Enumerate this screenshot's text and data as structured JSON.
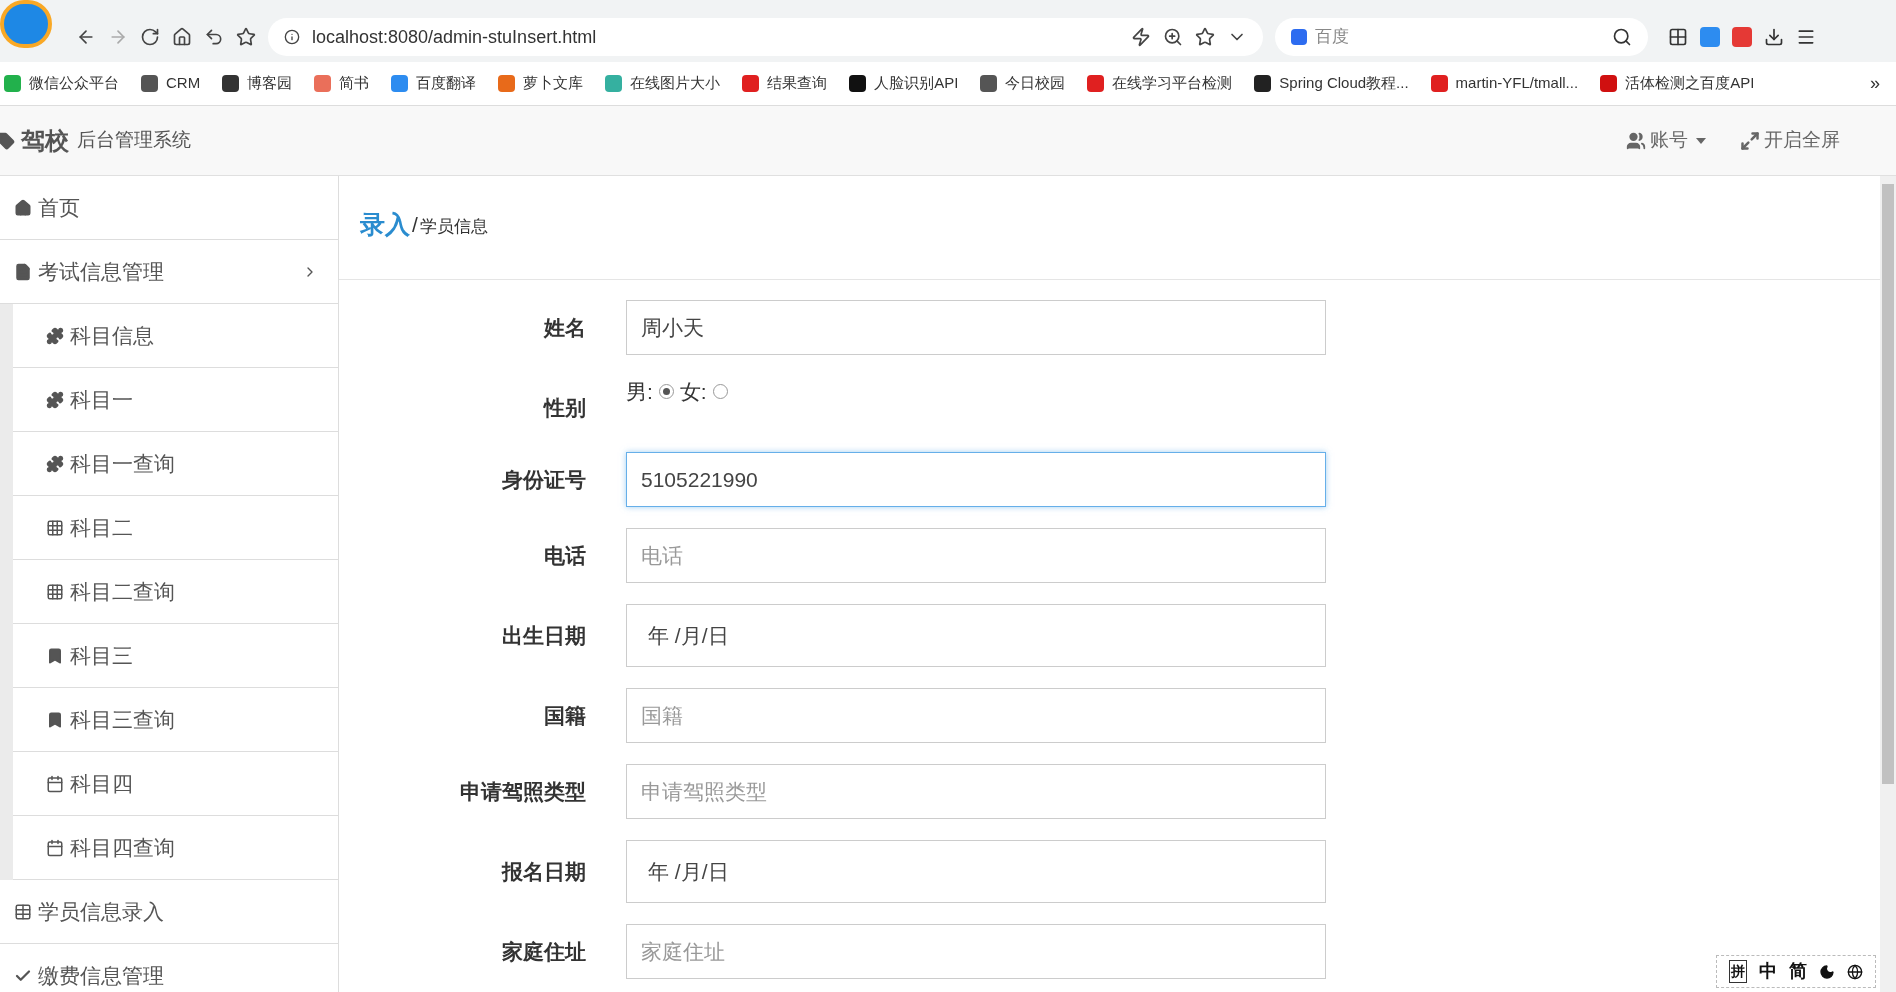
{
  "browser": {
    "url": "localhost:8080/admin-stuInsert.html",
    "search_placeholder": "百度"
  },
  "bookmarks": [
    {
      "label": "微信公众平台",
      "color": "#22b14c"
    },
    {
      "label": "CRM",
      "color": "#555555"
    },
    {
      "label": "博客园",
      "color": "#333333"
    },
    {
      "label": "简书",
      "color": "#ea6f5a"
    },
    {
      "label": "百度翻译",
      "color": "#2d8cf0"
    },
    {
      "label": "萝卜文库",
      "color": "#e86a1a"
    },
    {
      "label": "在线图片大小",
      "color": "#35b0a0"
    },
    {
      "label": "结果查询",
      "color": "#e02020"
    },
    {
      "label": "人脸识别API",
      "color": "#111111"
    },
    {
      "label": "今日校园",
      "color": "#555555"
    },
    {
      "label": "在线学习平台检测",
      "color": "#e02020"
    },
    {
      "label": "Spring Cloud教程...",
      "color": "#222222"
    },
    {
      "label": "martin-YFL/tmall...",
      "color": "#e02020"
    },
    {
      "label": "活体检测之百度API",
      "color": "#d01010"
    }
  ],
  "bookmarks_more": "»",
  "header": {
    "brand": "驾校",
    "subtitle": "后台管理系统",
    "account": "账号",
    "fullscreen": "开启全屏"
  },
  "sidebar": [
    {
      "label": "首页"
    },
    {
      "label": "考试信息管理",
      "expanded": true,
      "children": [
        {
          "label": "科目信息"
        },
        {
          "label": "科目一"
        },
        {
          "label": "科目一查询"
        },
        {
          "label": "科目二"
        },
        {
          "label": "科目二查询"
        },
        {
          "label": "科目三"
        },
        {
          "label": "科目三查询"
        },
        {
          "label": "科目四"
        },
        {
          "label": "科目四查询"
        }
      ]
    },
    {
      "label": "学员信息录入"
    },
    {
      "label": "缴费信息管理"
    }
  ],
  "breadcrumb": {
    "current": "录入",
    "separator": "/",
    "section": "学员信息"
  },
  "form": [
    {
      "kind": "text",
      "label": "姓名",
      "value": "周小天",
      "focused": false
    },
    {
      "kind": "radio",
      "label": "性别",
      "options": [
        {
          "label": "男:",
          "selected": true
        },
        {
          "label": "女:",
          "selected": false
        }
      ]
    },
    {
      "kind": "text",
      "label": "身份证号",
      "value": "5105221990",
      "focused": true
    },
    {
      "kind": "text",
      "label": "电话",
      "placeholder": "电话",
      "focused": false
    },
    {
      "kind": "date",
      "label": "出生日期",
      "value": "年 /月/日",
      "focused": false
    },
    {
      "kind": "text",
      "label": "国籍",
      "placeholder": "国籍",
      "focused": false
    },
    {
      "kind": "text",
      "label": "申请驾照类型",
      "placeholder": "申请驾照类型",
      "focused": false
    },
    {
      "kind": "date",
      "label": "报名日期",
      "value": "年 /月/日",
      "focused": false
    },
    {
      "kind": "text",
      "label": "家庭住址",
      "placeholder": "家庭住址",
      "focused": false
    }
  ],
  "ime_toolbar": [
    "拼",
    "中",
    "简"
  ]
}
